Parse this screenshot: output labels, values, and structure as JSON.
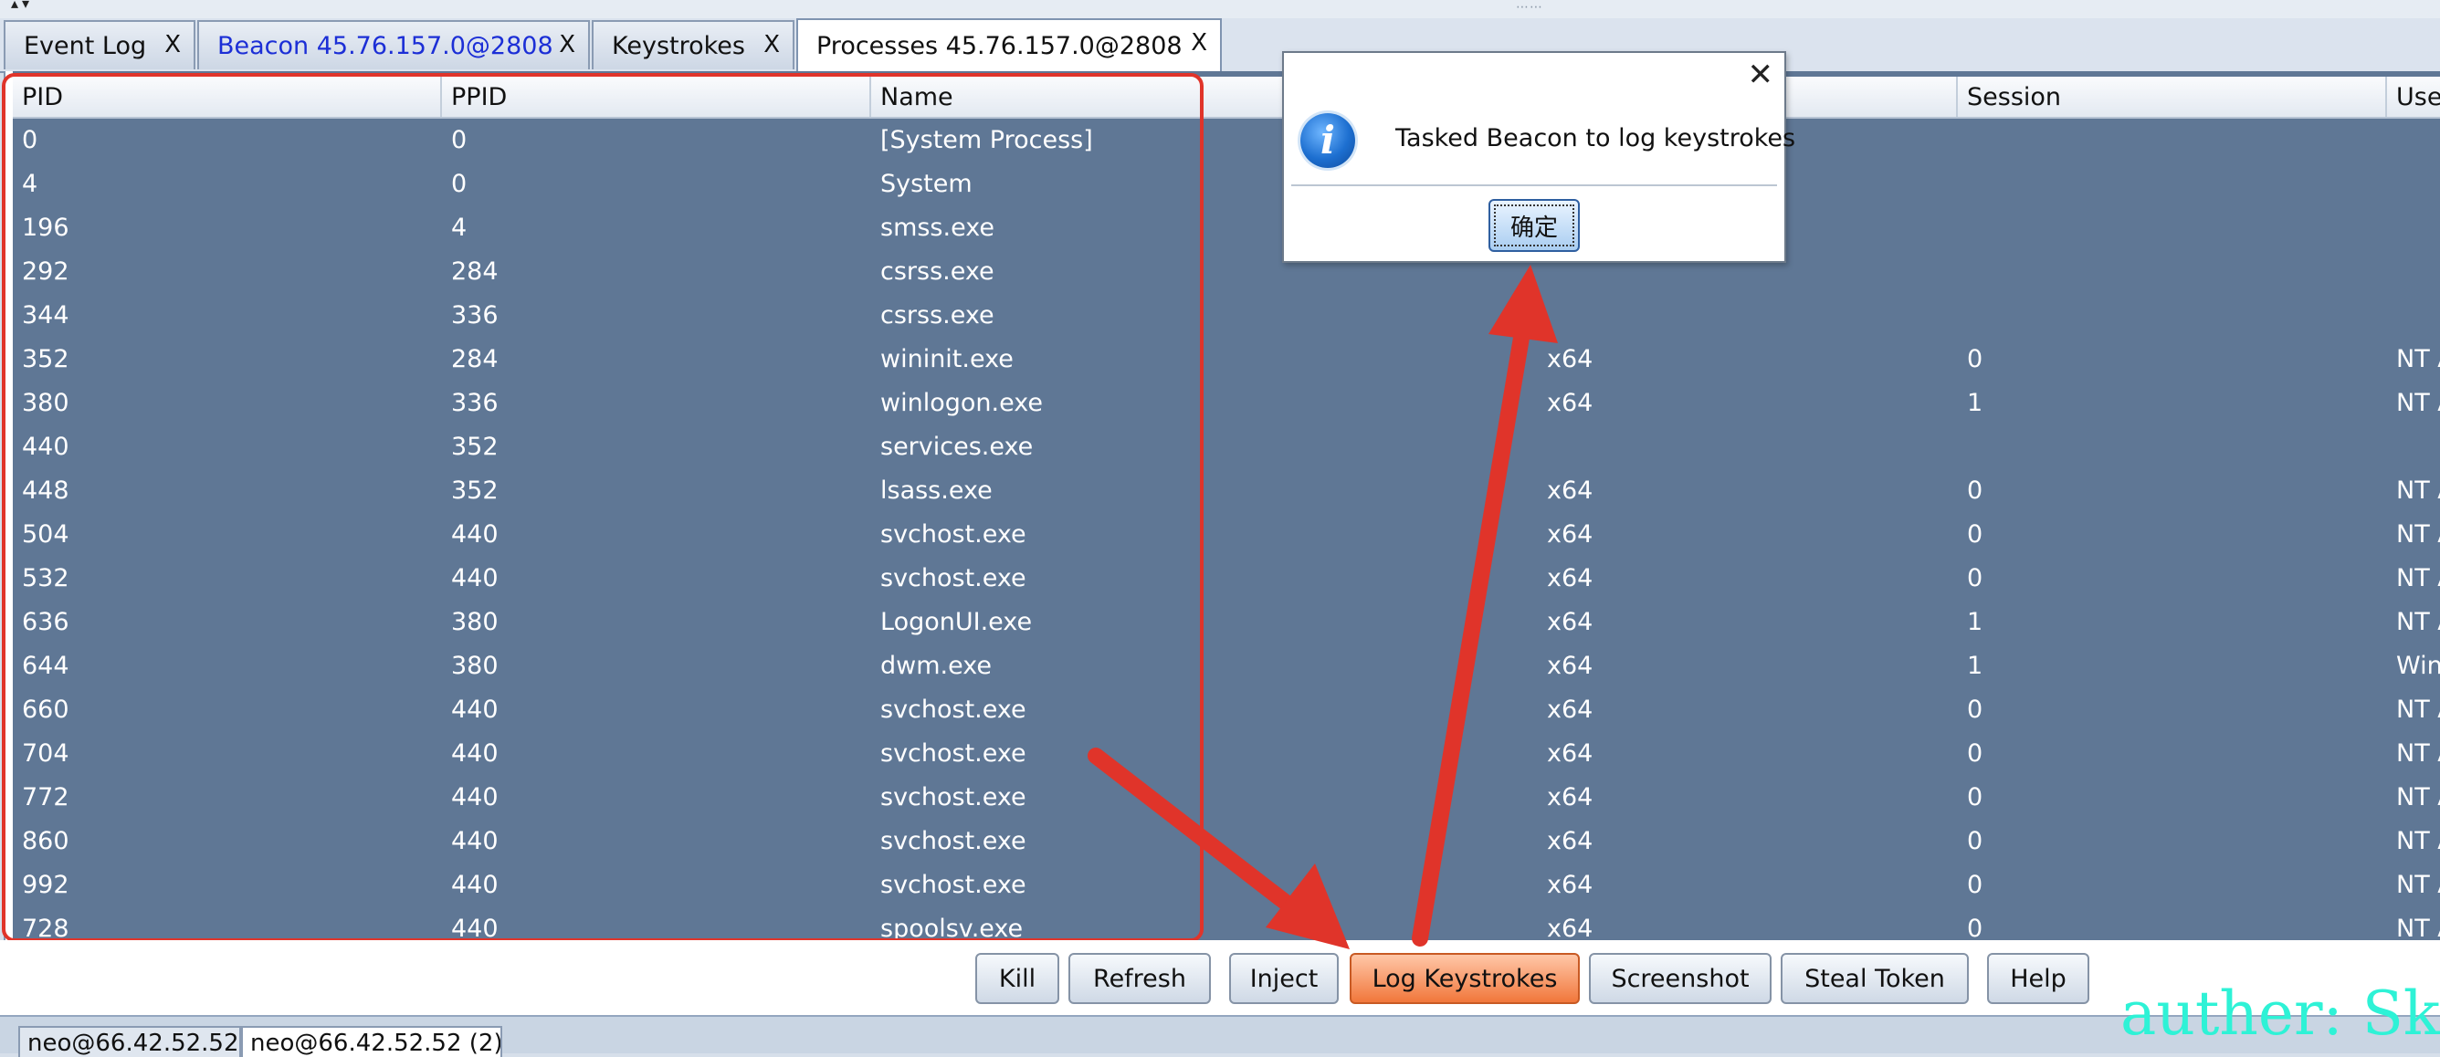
{
  "tabs": [
    {
      "label": "Event Log",
      "close": "X"
    },
    {
      "label": "Beacon 45.76.157.0@2808",
      "close": "X"
    },
    {
      "label": "Keystrokes",
      "close": "X"
    },
    {
      "label": "Processes 45.76.157.0@2808",
      "close": "X"
    }
  ],
  "table": {
    "columns": [
      "PID",
      "PPID",
      "Name",
      "",
      "Session",
      "User"
    ],
    "rows": [
      [
        "0",
        "0",
        "[System Process]",
        "",
        "",
        ""
      ],
      [
        "4",
        "0",
        "System",
        "",
        "",
        ""
      ],
      [
        "196",
        "4",
        "smss.exe",
        "",
        "",
        ""
      ],
      [
        "292",
        "284",
        "csrss.exe",
        "",
        "",
        ""
      ],
      [
        "344",
        "336",
        "csrss.exe",
        "",
        "",
        ""
      ],
      [
        "352",
        "284",
        "wininit.exe",
        "x64",
        "0",
        "NT A"
      ],
      [
        "380",
        "336",
        "winlogon.exe",
        "x64",
        "1",
        "NT A"
      ],
      [
        "440",
        "352",
        "services.exe",
        "",
        "",
        ""
      ],
      [
        "448",
        "352",
        "lsass.exe",
        "x64",
        "0",
        "NT A"
      ],
      [
        "504",
        "440",
        "svchost.exe",
        "x64",
        "0",
        "NT A"
      ],
      [
        "532",
        "440",
        "svchost.exe",
        "x64",
        "0",
        "NT A"
      ],
      [
        "636",
        "380",
        "LogonUI.exe",
        "x64",
        "1",
        "NT A"
      ],
      [
        "644",
        "380",
        "dwm.exe",
        "x64",
        "1",
        "Wind"
      ],
      [
        "660",
        "440",
        "svchost.exe",
        "x64",
        "0",
        "NT A"
      ],
      [
        "704",
        "440",
        "svchost.exe",
        "x64",
        "0",
        "NT A"
      ],
      [
        "772",
        "440",
        "svchost.exe",
        "x64",
        "0",
        "NT A"
      ],
      [
        "860",
        "440",
        "svchost.exe",
        "x64",
        "0",
        "NT A"
      ],
      [
        "992",
        "440",
        "svchost.exe",
        "x64",
        "0",
        "NT A"
      ],
      [
        "728",
        "440",
        "spoolsv.exe",
        "x64",
        "0",
        "NT A"
      ]
    ]
  },
  "buttons": {
    "kill": "Kill",
    "refresh": "Refresh",
    "inject": "Inject",
    "log_keystrokes": "Log Keystrokes",
    "screenshot": "Screenshot",
    "steal_token": "Steal Token",
    "help": "Help"
  },
  "dialog": {
    "close": "✕",
    "message": "Tasked Beacon to log keystrokes",
    "ok": "确定"
  },
  "status_tabs": [
    "neo@66.42.52.52",
    "neo@66.42.52.52 (2)"
  ],
  "watermark": "auther: Ske",
  "colors": {
    "selected_row_bg": "#5f7795",
    "highlight_red": "#e0342a",
    "hot_button": "#f1773b",
    "watermark": "#2ef2d6"
  },
  "icons": {
    "dialog": "info-icon"
  }
}
